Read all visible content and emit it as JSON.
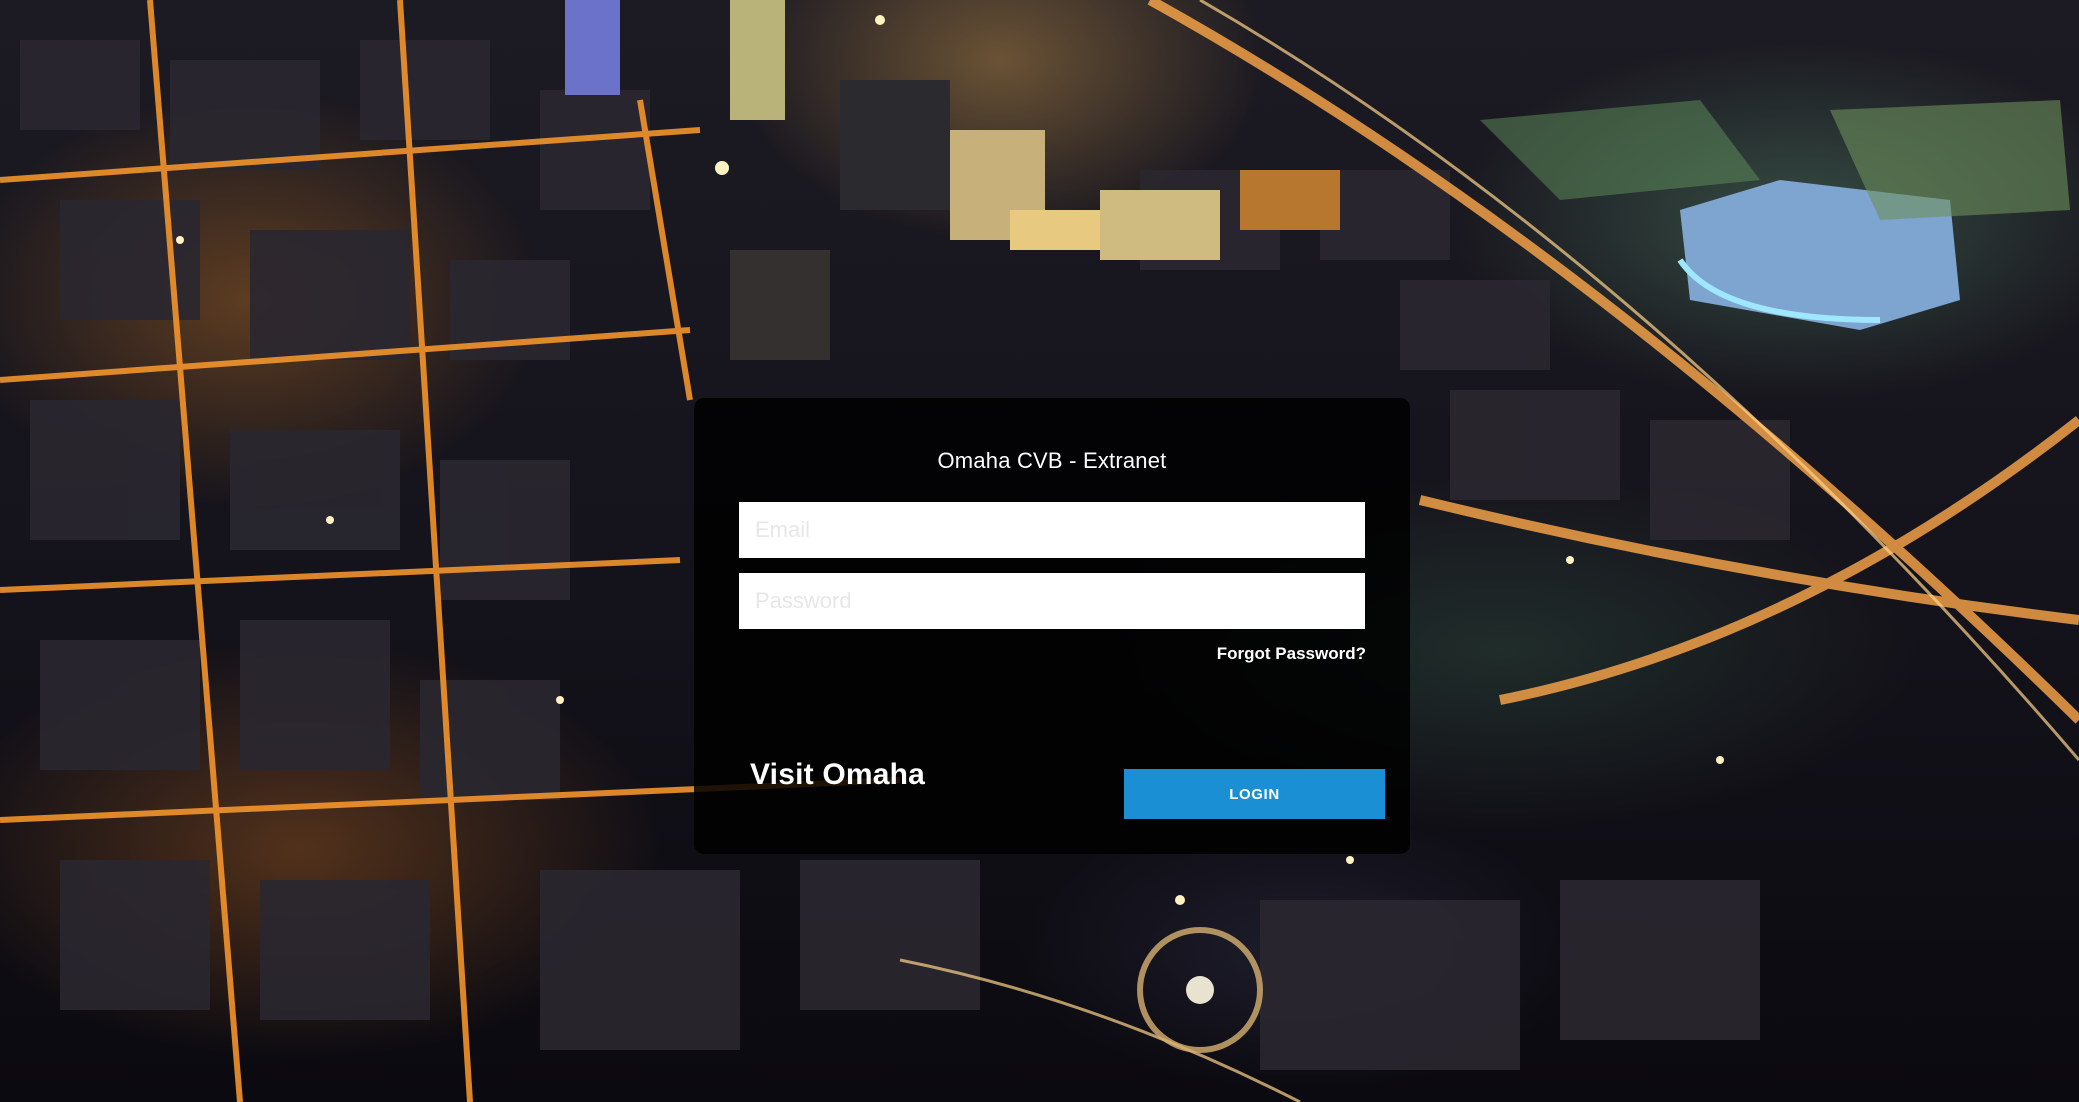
{
  "login": {
    "title": "Omaha CVB - Extranet",
    "email_placeholder": "Email",
    "password_placeholder": "Password",
    "forgot_label": "Forgot Password?",
    "brand": "Visit Omaha",
    "login_label": "LOGIN"
  },
  "colors": {
    "card_background": "#000000",
    "login_button": "#1b8fd3",
    "text": "#ffffff"
  }
}
